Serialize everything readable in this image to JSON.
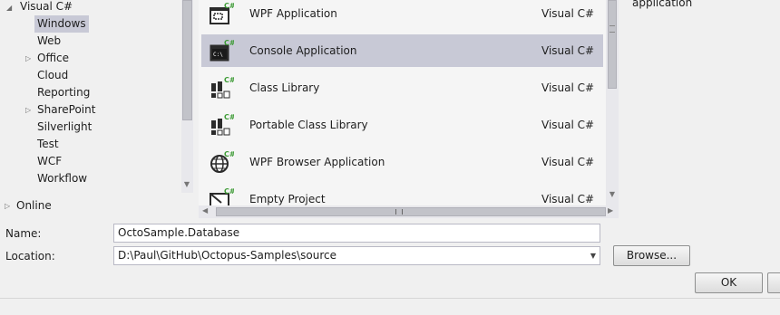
{
  "tree": {
    "items": [
      {
        "label": "Visual C#"
      },
      {
        "label": "Windows"
      },
      {
        "label": "Web"
      },
      {
        "label": "Office"
      },
      {
        "label": "Cloud"
      },
      {
        "label": "Reporting"
      },
      {
        "label": "SharePoint"
      },
      {
        "label": "Silverlight"
      },
      {
        "label": "Test"
      },
      {
        "label": "WCF"
      },
      {
        "label": "Workflow"
      },
      {
        "label": "Online"
      }
    ],
    "selected": "Windows"
  },
  "templates": [
    {
      "name": "WPF Application",
      "lang": "Visual C#",
      "icon": "wpf-application-icon"
    },
    {
      "name": "Console Application",
      "lang": "Visual C#",
      "icon": "console-application-icon",
      "selected": true
    },
    {
      "name": "Class Library",
      "lang": "Visual C#",
      "icon": "class-library-icon"
    },
    {
      "name": "Portable Class Library",
      "lang": "Visual C#",
      "icon": "portable-class-library-icon"
    },
    {
      "name": "WPF Browser Application",
      "lang": "Visual C#",
      "icon": "wpf-browser-application-icon"
    },
    {
      "name": "Empty Project",
      "lang": "Visual C#",
      "icon": "empty-project-icon"
    }
  ],
  "description": {
    "text": "application"
  },
  "form": {
    "name_label": "Name:",
    "name_value": "OctoSample.Database",
    "location_label": "Location:",
    "location_value": "D:\\Paul\\GitHub\\Octopus-Samples\\source",
    "browse_label": "Browse...",
    "ok_label": "OK"
  },
  "icon_glyphs": {
    "console_prompt": "C:\\",
    "csharp_badge": "C#"
  },
  "colors": {
    "selection": "#c8c9d6",
    "background": "#f0f0f0",
    "list_background": "#f5f5f5",
    "csharp_green": "#3d9b35"
  }
}
